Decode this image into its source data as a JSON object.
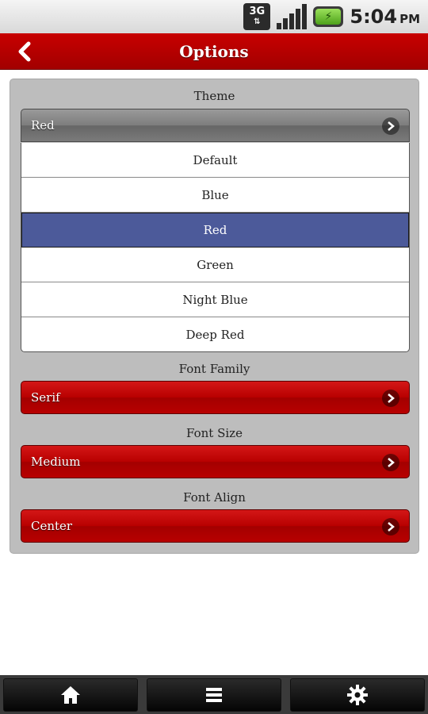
{
  "status_bar": {
    "network": "3G",
    "time": "5:04",
    "ampm": "PM",
    "icons": [
      "network-3g-icon",
      "signal-icon",
      "battery-charging-icon"
    ]
  },
  "header": {
    "title": "Options",
    "back_icon": "chevron-left-icon"
  },
  "theme": {
    "label": "Theme",
    "selected": "Red",
    "options": [
      "Default",
      "Blue",
      "Red",
      "Green",
      "Night Blue",
      "Deep Red"
    ],
    "selected_color": "#4c5a9a"
  },
  "font_family": {
    "label": "Font Family",
    "value": "Serif"
  },
  "font_size": {
    "label": "Font Size",
    "value": "Medium"
  },
  "font_align": {
    "label": "Font Align",
    "value": "Center"
  },
  "bottom_nav": [
    "home-icon",
    "menu-icon",
    "settings-icon"
  ],
  "colors": {
    "accent": "#b80000",
    "panel": "#bdbdbd"
  }
}
